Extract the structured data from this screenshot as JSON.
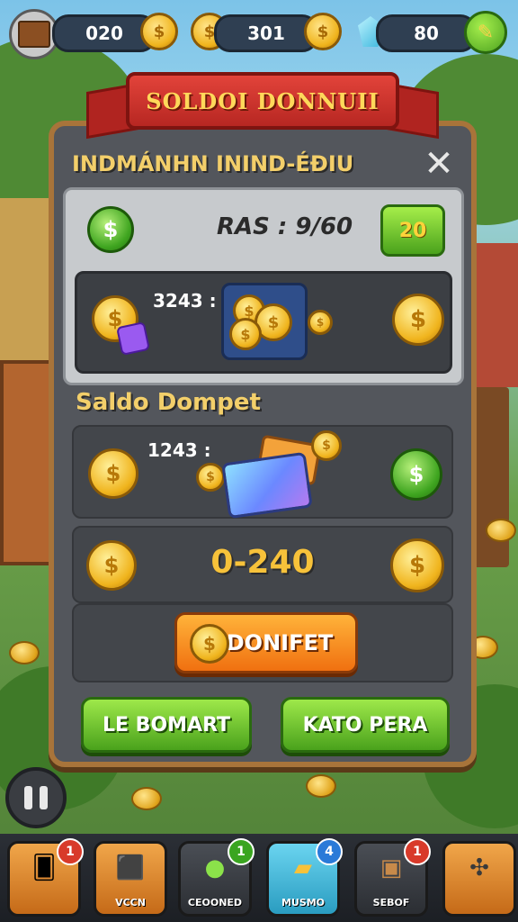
{
  "top_bar": {
    "coins_value": "020",
    "gold_value": "301",
    "gems_value": "80"
  },
  "ribbon": {
    "title": "SOLDOI DONNUII"
  },
  "panel": {
    "header": "INDMÁNHN ININD-ÉÐIU",
    "close_glyph": "✕",
    "row1": {
      "label": "RAS : 9/60",
      "button_value": "20"
    },
    "row2": {
      "label": "3243 :"
    },
    "section_title": "Saldo Dompet",
    "row3": {
      "label": "1243 :"
    },
    "row4": {
      "value": "0-240"
    },
    "dompet_button": "DONIFET",
    "left_button": "LE BOMART",
    "right_button": "KATO PERA"
  },
  "dock": [
    {
      "label": "",
      "badge": "1",
      "icon": "cards-icon",
      "color": "#d88a2e"
    },
    {
      "label": "VCCN",
      "badge": "",
      "icon": "cube-icon",
      "color": "#d88a2e"
    },
    {
      "label": "CEOONED",
      "badge": "1",
      "icon": "coin-icon",
      "color": "#3a3d42"
    },
    {
      "label": "MUSMO",
      "badge": "4",
      "icon": "gold-bar-icon",
      "color": "#3ab7d8"
    },
    {
      "label": "SEBOF",
      "badge": "1",
      "icon": "chest-icon",
      "color": "#3a3d42"
    },
    {
      "label": "",
      "badge": "",
      "icon": "tools-icon",
      "color": "#d88a2e"
    }
  ],
  "colors": {
    "panel": "#53565c",
    "accent_gold": "#f3cf6a",
    "green_button": "#4aa21c",
    "orange_button": "#f07010",
    "ribbon_red": "#b72722"
  }
}
